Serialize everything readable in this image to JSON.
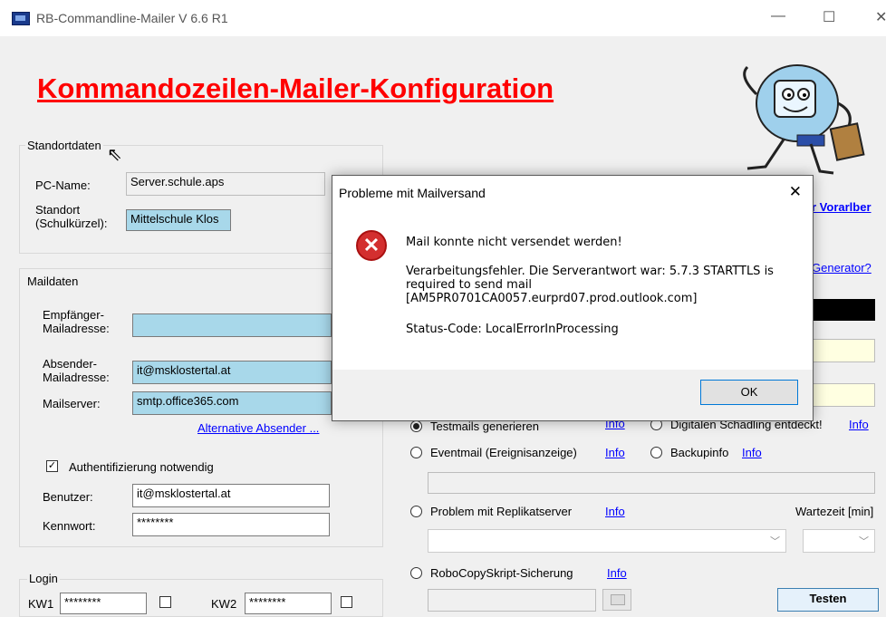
{
  "window": {
    "title": "RB-Commandline-Mailer V  6.6 R1",
    "minimize": "—",
    "maximize": "☐",
    "close": "✕"
  },
  "heading": "Kommandozeilen-Mailer-Konfiguration",
  "site": {
    "legend": "Standortdaten",
    "pc_label": "PC-Name:",
    "pc_value": "Server.schule.aps",
    "site_label_1": "Standort",
    "site_label_2": "(Schulkürzel):",
    "site_value": "Mittelschule Klos"
  },
  "mail": {
    "legend": "Maildaten",
    "recipient_label_1": "Empfänger-",
    "recipient_label_2": "Mailadresse:",
    "recipient_value": "",
    "sender_label_1": "Absender-",
    "sender_label_2": "Mailadresse:",
    "sender_value": "it@msklostertal.at",
    "server_label": "Mailserver:",
    "server_value": "smtp.office365.com",
    "alt_sender_link": "Alternative Absender ...",
    "auth_label": "Authentifizierung notwendig",
    "auth_checked": "✓",
    "user_label": "Benutzer:",
    "user_value": "it@msklostertal.at",
    "password_label": "Kennwort:",
    "password_value": "********"
  },
  "login": {
    "legend": "Login",
    "kw1_label": "KW1",
    "kw1_value": "********",
    "kw2_label": "KW2",
    "kw2_value": "********"
  },
  "right": {
    "vorarlberg_link": "r Vorarlber",
    "generator_link": "Generator?",
    "testmails_label": "Testmails generieren",
    "testmails_info": "Info",
    "malware_label": "Digitalen Schädling entdeckt!",
    "malware_info": "Info",
    "eventmail_label": "Eventmail (Ereignisanzeige)",
    "eventmail_info": "Info",
    "backup_label": "Backupinfo",
    "backup_info": "Info",
    "replica_label": "Problem mit Replikatserver",
    "replica_info": "Info",
    "wait_label": "Wartezeit [min]",
    "robocopy_label": "RoboCopySkript-Sicherung",
    "robocopy_info": "Info",
    "test_button": "Testen"
  },
  "dialog": {
    "title": "Probleme mit Mailversand",
    "close": "✕",
    "icon": "error-icon",
    "line1": "Mail konnte nicht versendet werden!",
    "line2": "Verarbeitungsfehler. Die Serverantwort war: 5.7.3 STARTTLS is",
    "line3": "required to send mail",
    "line4": "[AM5PR0701CA0057.eurprd07.prod.outlook.com]",
    "line5": "Status-Code: LocalErrorInProcessing",
    "ok": "OK"
  },
  "colors": {
    "heading": "#ff0000",
    "field_highlight": "#a8d8ea",
    "link": "#0000ff",
    "error": "#d32f2f"
  }
}
